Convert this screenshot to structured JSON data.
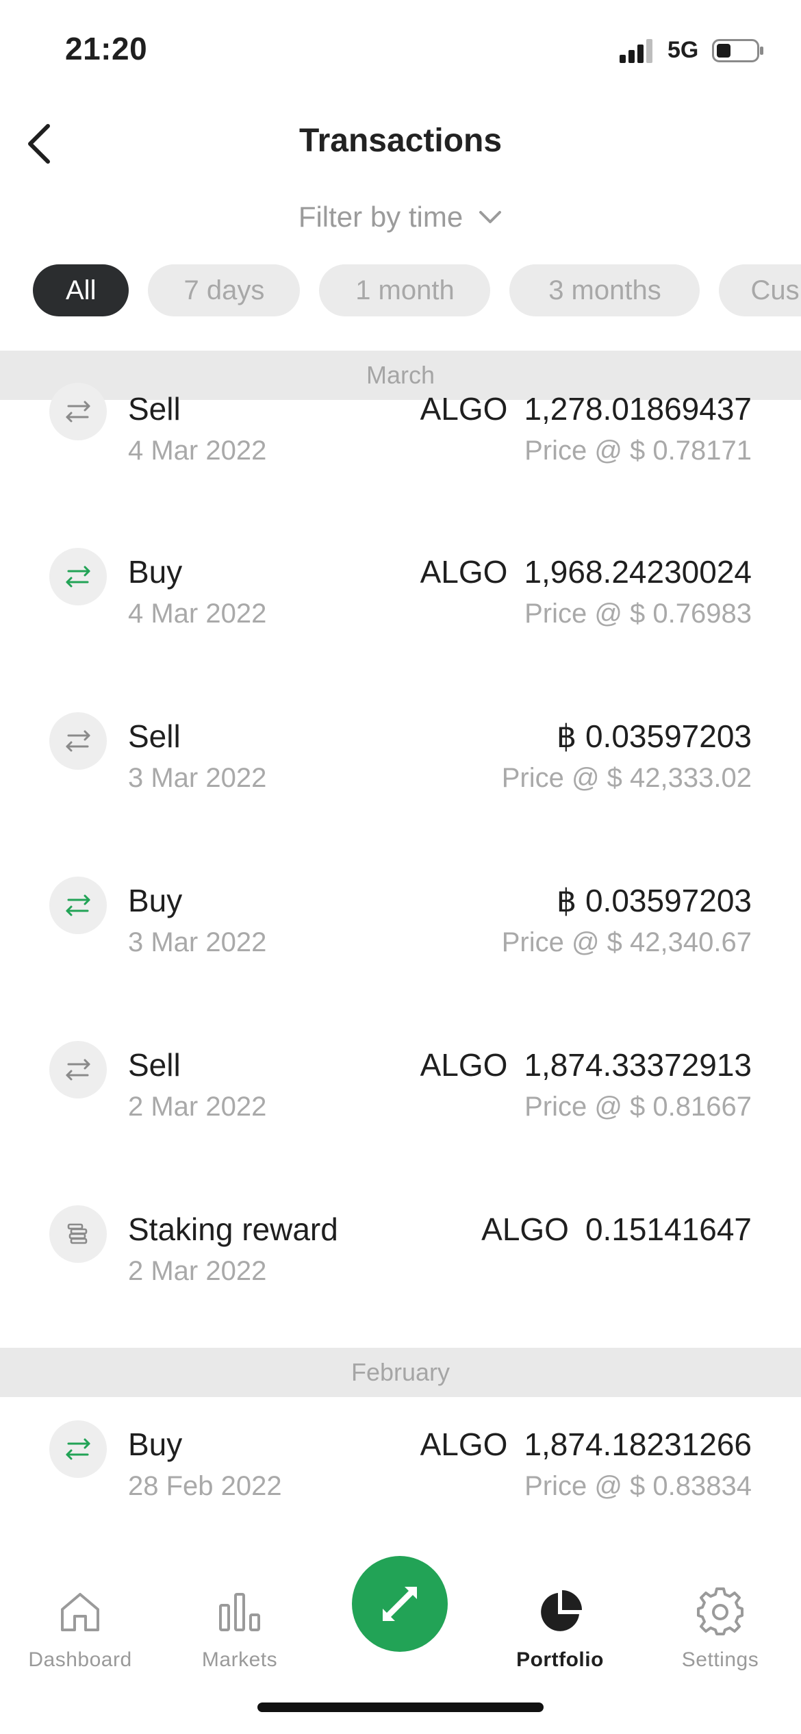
{
  "status_bar": {
    "time": "21:20",
    "network": "5G"
  },
  "header": {
    "title": "Transactions"
  },
  "filter": {
    "label": "Filter by time",
    "chips": [
      "All",
      "7 days",
      "1 month",
      "3 months",
      "Cus"
    ]
  },
  "sections": [
    {
      "title": "March",
      "transactions": [
        {
          "type": "Sell",
          "date": "4 Mar 2022",
          "asset": "ALGO",
          "amount": "1,278.01869437",
          "price": "Price @ $ 0.78171",
          "icon": "swap-icon",
          "icon_color": "#8a8a8a"
        },
        {
          "type": "Buy",
          "date": "4 Mar 2022",
          "asset": "ALGO",
          "amount": "1,968.24230024",
          "price": "Price @ $ 0.76983",
          "icon": "swap-icon",
          "icon_color": "#22a356"
        },
        {
          "type": "Sell",
          "date": "3 Mar 2022",
          "asset": "",
          "amount": "฿ 0.03597203",
          "price": "Price @ $ 42,333.02",
          "icon": "swap-icon",
          "icon_color": "#8a8a8a"
        },
        {
          "type": "Buy",
          "date": "3 Mar 2022",
          "asset": "",
          "amount": "฿ 0.03597203",
          "price": "Price @ $ 42,340.67",
          "icon": "swap-icon",
          "icon_color": "#22a356"
        },
        {
          "type": "Sell",
          "date": "2 Mar 2022",
          "asset": "ALGO",
          "amount": "1,874.33372913",
          "price": "Price @ $ 0.81667",
          "icon": "swap-icon",
          "icon_color": "#8a8a8a"
        },
        {
          "type": "Staking reward",
          "date": "2 Mar 2022",
          "asset": "ALGO",
          "amount": "0.15141647",
          "price": "",
          "icon": "coins-stack-icon",
          "icon_color": "#8a8a8a"
        }
      ]
    },
    {
      "title": "February",
      "transactions": [
        {
          "type": "Buy",
          "date": "28 Feb 2022",
          "asset": "ALGO",
          "amount": "1,874.18231266",
          "price": "Price @ $ 0.83834",
          "icon": "swap-icon",
          "icon_color": "#22a356"
        }
      ]
    }
  ],
  "tabbar": {
    "tabs": [
      "Dashboard",
      "Markets",
      "Portfolio",
      "Settings"
    ],
    "active": "Portfolio",
    "accent": "#22a356"
  }
}
